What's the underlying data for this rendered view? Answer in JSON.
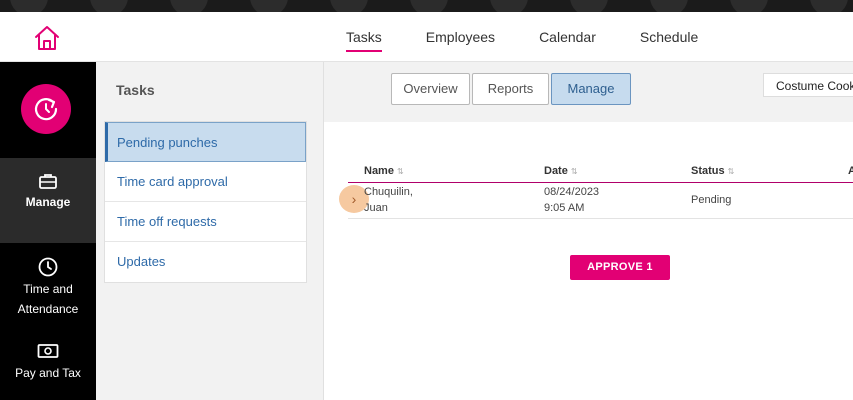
{
  "header": {
    "tabs": [
      {
        "label": "Tasks"
      },
      {
        "label": "Employees"
      },
      {
        "label": "Calendar"
      },
      {
        "label": "Schedule"
      }
    ]
  },
  "rail": {
    "items": [
      {
        "label": "Manage",
        "icon": "briefcase-icon"
      },
      {
        "label_line1": "Time and",
        "label_line2": "Attendance",
        "icon": "clock-icon"
      },
      {
        "label": "Pay and Tax",
        "icon": "money-icon"
      }
    ]
  },
  "subpanel": {
    "title": "Tasks",
    "items": [
      {
        "label": "Pending punches"
      },
      {
        "label": "Time card approval"
      },
      {
        "label": "Time off requests"
      },
      {
        "label": "Updates"
      }
    ]
  },
  "view_toggle": {
    "options": [
      {
        "label": "Overview"
      },
      {
        "label": "Reports"
      },
      {
        "label": "Manage"
      }
    ]
  },
  "company_selector": {
    "value": "Costume Cook"
  },
  "table": {
    "columns": [
      {
        "label": "Name"
      },
      {
        "label": "Date"
      },
      {
        "label": "Status"
      },
      {
        "label": "A"
      }
    ],
    "rows": [
      {
        "name_line1": "Chuquilin,",
        "name_line2": "Juan",
        "date_line1": "08/24/2023",
        "date_line2": "9:05 AM",
        "status": "Pending"
      }
    ]
  },
  "actions": {
    "approve_label": "APPROVE 1"
  },
  "colors": {
    "accent": "#e20074",
    "link": "#2e6aa8",
    "selected_bg": "#c8dcee"
  }
}
